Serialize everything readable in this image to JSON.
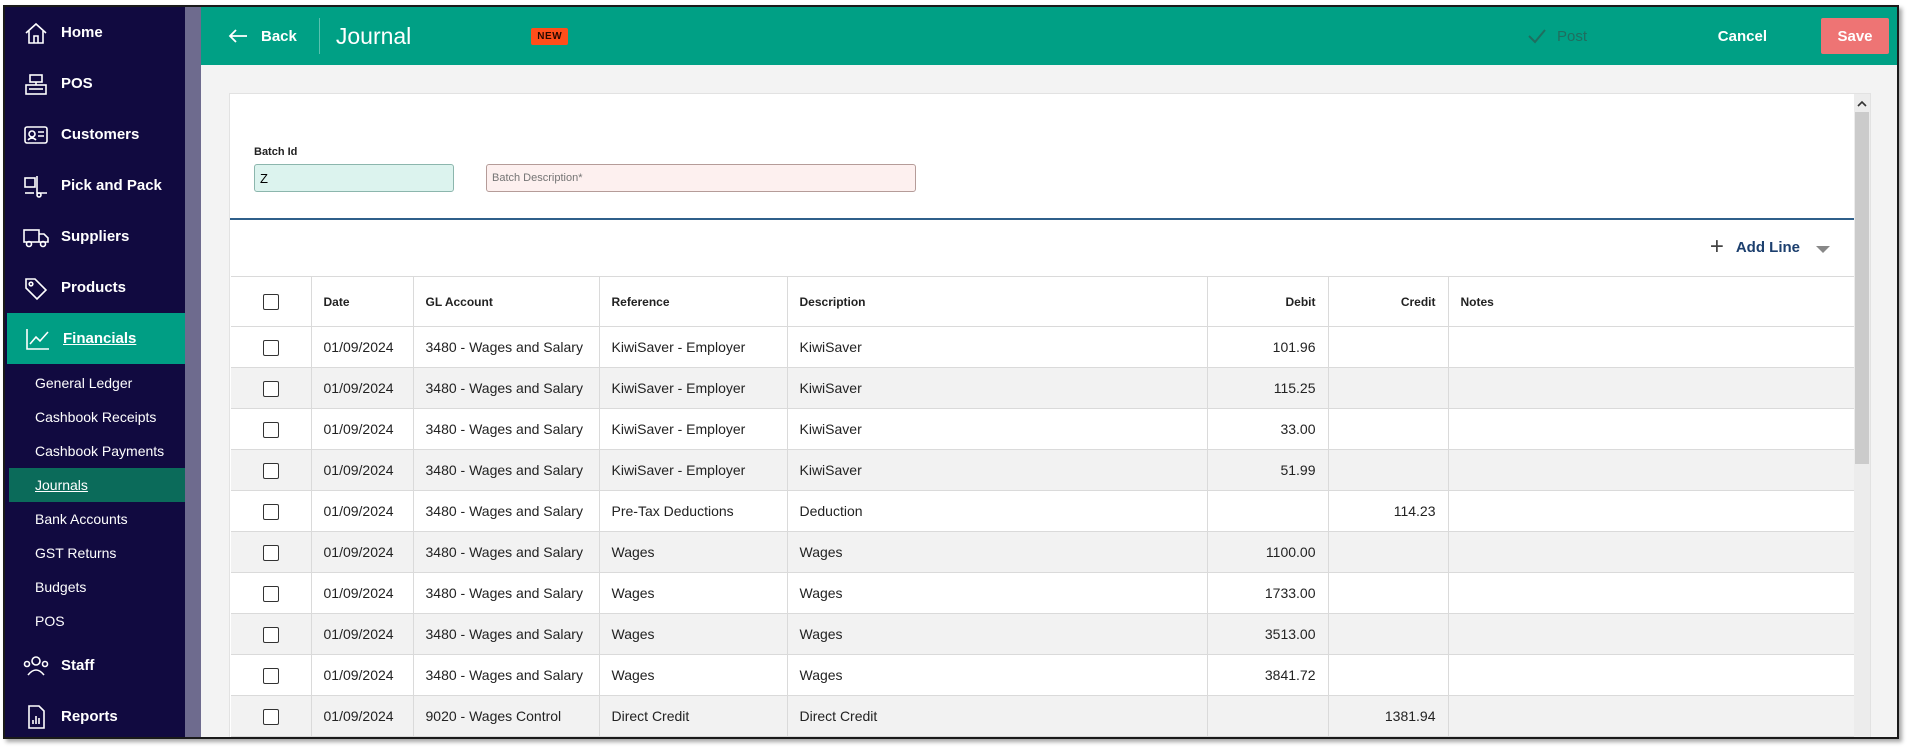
{
  "sidebar": {
    "items": [
      {
        "label": "Home",
        "icon": "home-icon"
      },
      {
        "label": "POS",
        "icon": "cash-register-icon"
      },
      {
        "label": "Customers",
        "icon": "id-card-icon"
      },
      {
        "label": "Pick and Pack",
        "icon": "hand-truck-icon"
      },
      {
        "label": "Suppliers",
        "icon": "truck-icon"
      },
      {
        "label": "Products",
        "icon": "tag-icon"
      },
      {
        "label": "Financials",
        "icon": "chart-line-icon"
      }
    ],
    "sub_items": [
      {
        "label": "General Ledger"
      },
      {
        "label": "Cashbook Receipts"
      },
      {
        "label": "Cashbook Payments"
      },
      {
        "label": "Journals"
      },
      {
        "label": "Bank Accounts"
      },
      {
        "label": "GST Returns"
      },
      {
        "label": "Budgets"
      },
      {
        "label": "POS"
      }
    ],
    "bottom_items": [
      {
        "label": "Staff",
        "icon": "people-icon"
      },
      {
        "label": "Reports",
        "icon": "report-icon"
      }
    ]
  },
  "header": {
    "back_label": "Back",
    "title": "Journal",
    "badge": "NEW",
    "post_label": "Post",
    "cancel_label": "Cancel",
    "save_label": "Save"
  },
  "form": {
    "batch_id_label": "Batch Id",
    "batch_id_value": "Z",
    "batch_description_placeholder": "Batch Description*"
  },
  "toolbar": {
    "add_line_label": "Add Line"
  },
  "table": {
    "headers": {
      "date": "Date",
      "gl_account": "GL Account",
      "reference": "Reference",
      "description": "Description",
      "debit": "Debit",
      "credit": "Credit",
      "notes": "Notes"
    },
    "rows": [
      {
        "date": "01/09/2024",
        "gl_account": "3480 - Wages and Salary",
        "reference": "KiwiSaver - Employer",
        "description": "KiwiSaver",
        "debit": "101.96",
        "credit": "",
        "notes": ""
      },
      {
        "date": "01/09/2024",
        "gl_account": "3480 - Wages and Salary",
        "reference": "KiwiSaver - Employer",
        "description": "KiwiSaver",
        "debit": "115.25",
        "credit": "",
        "notes": ""
      },
      {
        "date": "01/09/2024",
        "gl_account": "3480 - Wages and Salary",
        "reference": "KiwiSaver - Employer",
        "description": "KiwiSaver",
        "debit": "33.00",
        "credit": "",
        "notes": ""
      },
      {
        "date": "01/09/2024",
        "gl_account": "3480 - Wages and Salary",
        "reference": "KiwiSaver - Employer",
        "description": "KiwiSaver",
        "debit": "51.99",
        "credit": "",
        "notes": ""
      },
      {
        "date": "01/09/2024",
        "gl_account": "3480 - Wages and Salary",
        "reference": "Pre-Tax Deductions",
        "description": "Deduction",
        "debit": "",
        "credit": "114.23",
        "notes": ""
      },
      {
        "date": "01/09/2024",
        "gl_account": "3480 - Wages and Salary",
        "reference": "Wages",
        "description": "Wages",
        "debit": "1100.00",
        "credit": "",
        "notes": ""
      },
      {
        "date": "01/09/2024",
        "gl_account": "3480 - Wages and Salary",
        "reference": "Wages",
        "description": "Wages",
        "debit": "1733.00",
        "credit": "",
        "notes": ""
      },
      {
        "date": "01/09/2024",
        "gl_account": "3480 - Wages and Salary",
        "reference": "Wages",
        "description": "Wages",
        "debit": "3513.00",
        "credit": "",
        "notes": ""
      },
      {
        "date": "01/09/2024",
        "gl_account": "3480 - Wages and Salary",
        "reference": "Wages",
        "description": "Wages",
        "debit": "3841.72",
        "credit": "",
        "notes": ""
      },
      {
        "date": "01/09/2024",
        "gl_account": "9020 - Wages Control",
        "reference": "Direct Credit",
        "description": "Direct Credit",
        "debit": "",
        "credit": "1381.94",
        "notes": ""
      }
    ]
  },
  "colors": {
    "sidebar_bg": "#110a40",
    "header_bg": "#00a085",
    "active_nav": "#009e84",
    "active_sub": "#0b6b5a",
    "save_button": "#ee7474",
    "badge_new": "#ff4e1a"
  }
}
